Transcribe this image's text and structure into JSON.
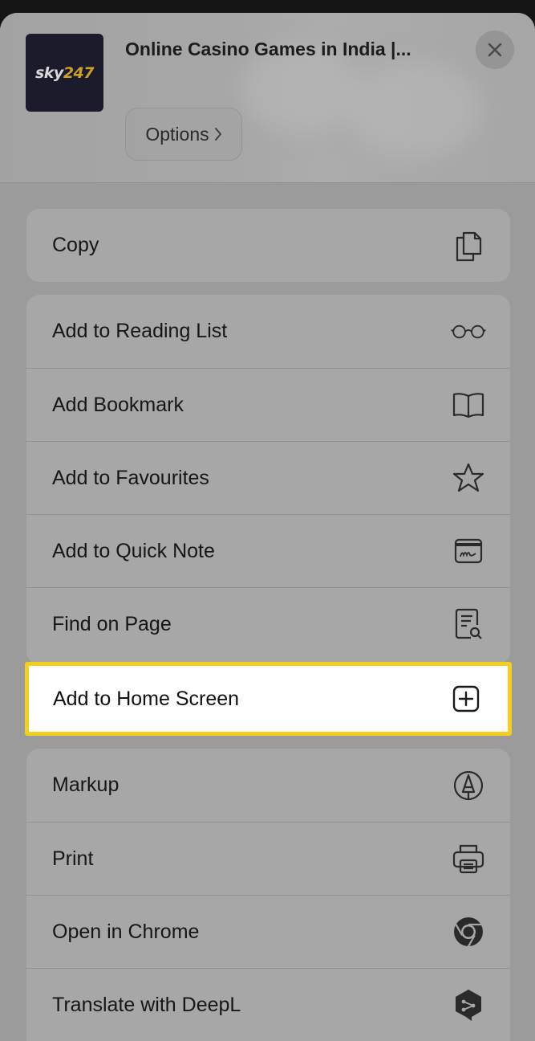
{
  "header": {
    "app_icon": {
      "logo_text_white": "sky",
      "logo_text_yellow": "247"
    },
    "title": "Online Casino Games in India |...",
    "options_label": "Options",
    "close_icon": "close-icon"
  },
  "copy_group": {
    "items": [
      {
        "label": "Copy",
        "icon": "copy-icon"
      }
    ]
  },
  "actions_group": {
    "items": [
      {
        "label": "Add to Reading List",
        "icon": "glasses-icon"
      },
      {
        "label": "Add Bookmark",
        "icon": "book-icon"
      },
      {
        "label": "Add to Favourites",
        "icon": "star-icon"
      },
      {
        "label": "Add to Quick Note",
        "icon": "quick-note-icon"
      },
      {
        "label": "Find on Page",
        "icon": "find-document-icon"
      },
      {
        "label": "Add to Home Screen",
        "icon": "plus-square-icon",
        "highlighted": true
      }
    ]
  },
  "extras_group": {
    "items": [
      {
        "label": "Markup",
        "icon": "markup-pen-icon"
      },
      {
        "label": "Print",
        "icon": "printer-icon"
      },
      {
        "label": "Open in Chrome",
        "icon": "chrome-icon"
      },
      {
        "label": "Translate with DeepL",
        "icon": "deepl-icon"
      }
    ]
  },
  "colors": {
    "highlight_border": "#f5cf1d",
    "overlay_bg": "#9b9b9b",
    "card_bg": "#a7a7a7"
  }
}
